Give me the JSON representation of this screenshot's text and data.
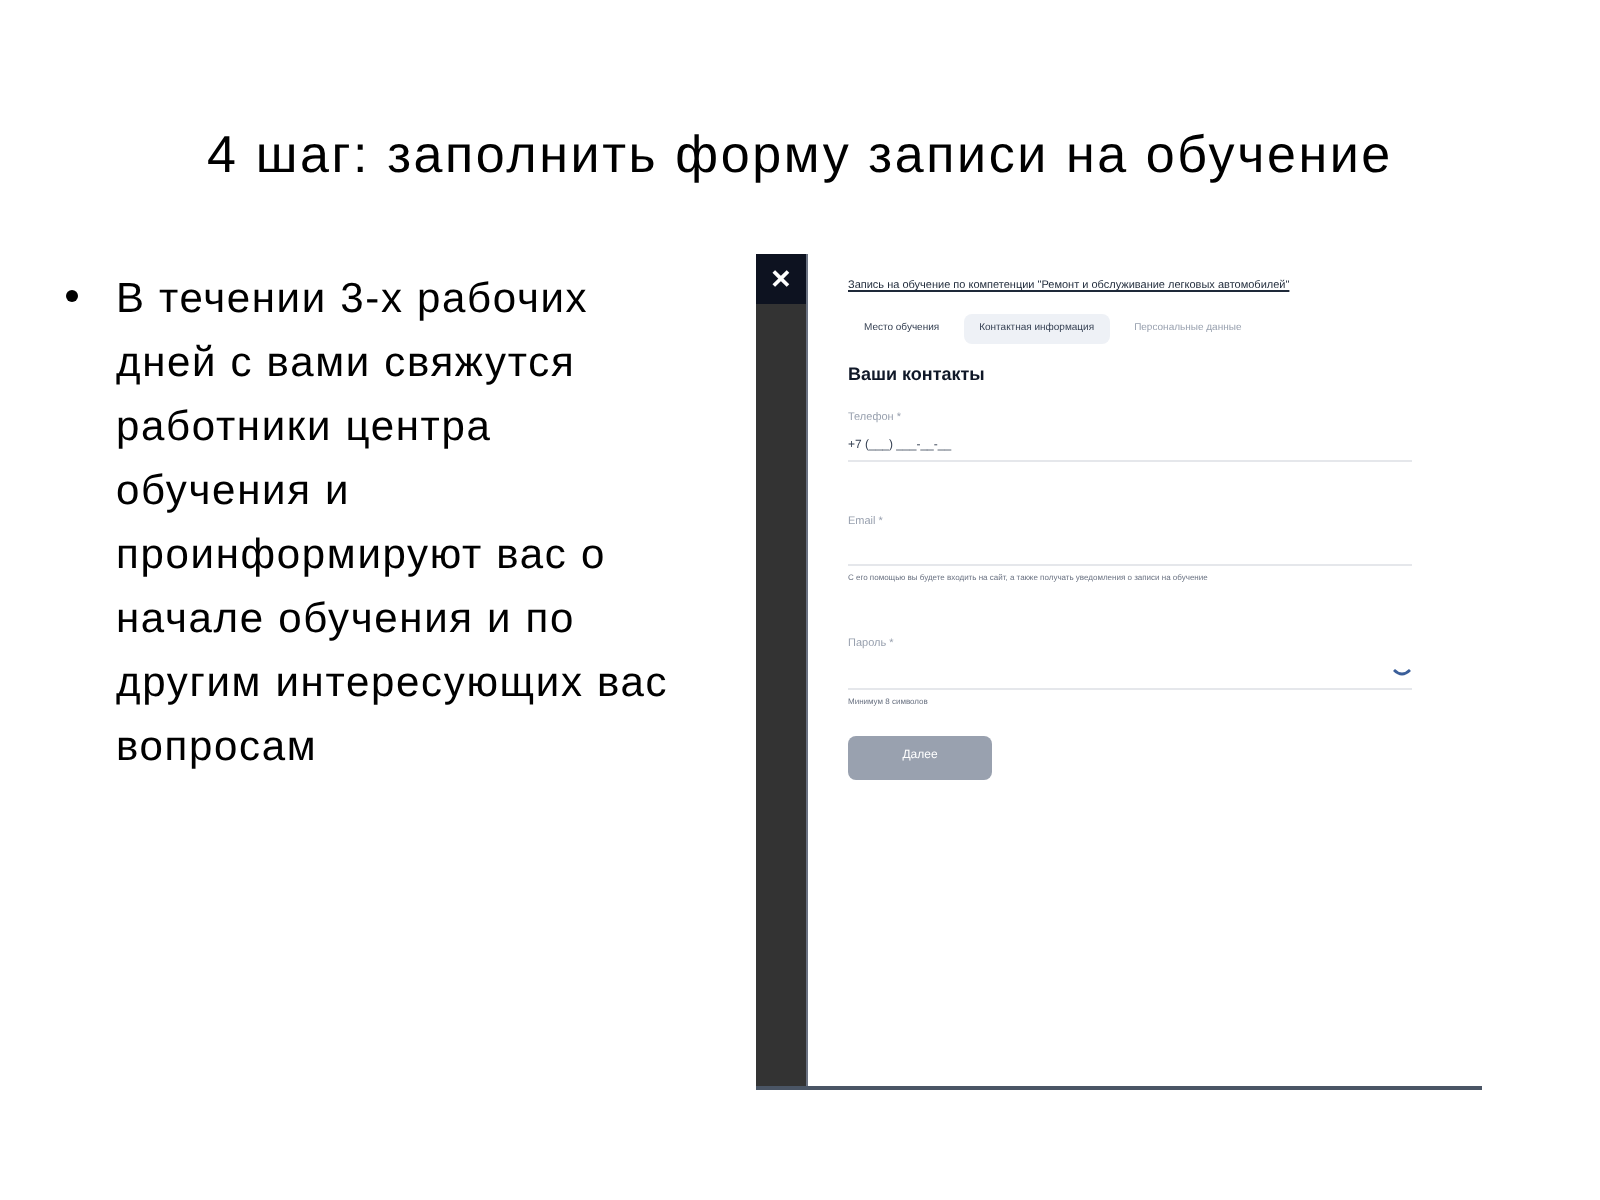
{
  "slide": {
    "title": "4 шаг: заполнить форму записи на обучение",
    "bullets": [
      "В течении 3-х рабочих дней с вами свяжутся работники центра обучения и проинформируют вас о начале обучения и по другим интересующих вас вопросам"
    ]
  },
  "screenshot": {
    "form_title": "Запись на обучение по компетенции \"Ремонт и обслуживание легковых автомобилей\"",
    "tabs": [
      {
        "label": "Место обучения",
        "selected": false,
        "disabled": false
      },
      {
        "label": "Контактная информация",
        "selected": true,
        "disabled": false
      },
      {
        "label": "Персональные данные",
        "selected": false,
        "disabled": true
      }
    ],
    "section_title": "Ваши контакты",
    "fields": [
      {
        "label": "Телефон *",
        "value": "+7 (___) ___-__-__",
        "kind": "text"
      },
      {
        "label": "Email *",
        "hint": "С его помощью вы будете входить на сайт, а также получать уведомления о записи на обучение",
        "kind": "text"
      },
      {
        "label": "Пароль *",
        "hint": "Минимум 8 символов",
        "kind": "password"
      }
    ],
    "next_button": {
      "label": "Далее",
      "disabled": true
    },
    "close_label": "✕"
  }
}
